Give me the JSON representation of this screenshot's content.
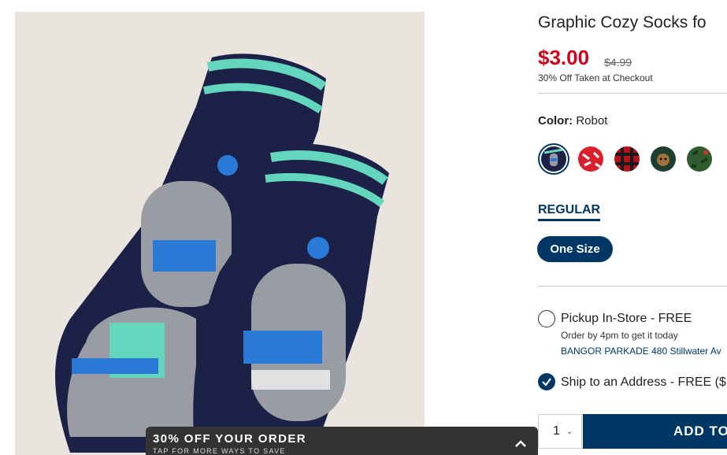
{
  "product": {
    "title": "Graphic Cozy Socks fo",
    "price": "$3.00",
    "original_price": "$4.99",
    "discount_note": "30% Off Taken at Checkout"
  },
  "color": {
    "label": "Color:",
    "value": "Robot",
    "swatches": [
      "robot",
      "red-white-pattern",
      "red-plaid",
      "reindeer",
      "green-holiday"
    ]
  },
  "variant": {
    "tab": "REGULAR",
    "size": "One Size"
  },
  "fulfillment": {
    "pickup_label": "Pickup In-Store - FREE",
    "pickup_note": "Order by 4pm to get it today",
    "store": "BANGOR PARKADE 480 Stillwater Av",
    "ship_label": "Ship to an Address - FREE ($"
  },
  "cart": {
    "quantity": "1",
    "add_label": "ADD TO"
  },
  "promo": {
    "headline": "30% OFF YOUR ORDER",
    "subline": "TAP FOR MORE WAYS TO SAVE"
  },
  "colors": {
    "brand_navy": "#003764",
    "sale_red": "#d0021b",
    "banner": "#333333"
  }
}
